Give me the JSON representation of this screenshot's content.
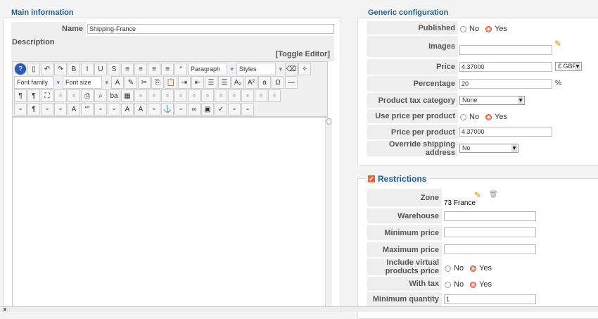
{
  "main": {
    "legend": "Main information",
    "name_label": "Name",
    "name_value": "Shipping-France",
    "description_label": "Description",
    "toggle_editor": "[Toggle Editor]",
    "editor": {
      "format_select": "Paragraph",
      "styles_select": "Styles",
      "font_family": "Font family",
      "font_size": "Font size",
      "row1": [
        "help-icon",
        "new-document-icon",
        "undo-icon",
        "redo-icon",
        "bold-icon",
        "italic-icon",
        "underline-icon",
        "strikethrough-icon",
        "align-justify-icon",
        "align-center-icon",
        "align-left-icon",
        "align-right-icon",
        "blockquote-icon"
      ],
      "row1b": [
        "eraser-icon",
        "cleanup-icon"
      ],
      "row2": [
        "text-color-icon",
        "highlight-icon",
        "cut-icon",
        "copy-icon",
        "paste-icon",
        "indent-icon",
        "outdent-icon",
        "numbered-list-icon",
        "bullet-list-icon",
        "subscript-icon",
        "superscript-icon",
        "style-icon",
        "special-char-icon",
        "horizontal-rule-icon"
      ],
      "row3": [
        "ltr-icon",
        "rtl-icon",
        "fullscreen-icon",
        "paste-word-icon",
        "paste-text-icon",
        "print-icon",
        "find-icon",
        "replace-icon",
        "table-icon",
        "delete-table-icon",
        "row-before-icon",
        "row-after-icon",
        "insert-row-icon",
        "insert-col-icon",
        "delete-row-icon",
        "col-before-icon",
        "col-after-icon",
        "delete-col-icon",
        "merge-cells-icon",
        "split-cells-icon"
      ],
      "row4": [
        "visual-aid-icon",
        "show-blocks-icon",
        "template-icon",
        "page-break-icon",
        "styleprops-icon",
        "cite-icon",
        "abbr-icon",
        "acronym-icon",
        "del-icon",
        "ins-icon",
        "attributes-icon",
        "anchor-icon",
        "unlink-icon",
        "link-icon",
        "image-icon",
        "spellcheck-icon",
        "nonbreaking-icon",
        "layer-icon"
      ]
    }
  },
  "generic": {
    "legend": "Generic configuration",
    "published": {
      "label": "Published",
      "no": "No",
      "yes": "Yes"
    },
    "images": {
      "label": "Images",
      "value": ""
    },
    "price": {
      "label": "Price",
      "value": "4.37000",
      "currency": "£ GBP"
    },
    "percentage": {
      "label": "Percentage",
      "value": "20",
      "unit": "%"
    },
    "tax": {
      "label": "Product tax category",
      "value": "None"
    },
    "use_price": {
      "label": "Use price per product",
      "no": "No",
      "yes": "Yes"
    },
    "price_per": {
      "label": "Price per product",
      "value": "4.37000"
    },
    "override": {
      "label": "Override shipping address",
      "value": "No"
    }
  },
  "restrictions": {
    "legend": "Restrictions",
    "zone": {
      "label": "Zone",
      "value": "73 France"
    },
    "warehouse": {
      "label": "Warehouse",
      "value": ""
    },
    "min_price": {
      "label": "Minimum price",
      "value": ""
    },
    "max_price": {
      "label": "Maximum price",
      "value": ""
    },
    "virtual": {
      "label": "Include virtual products price",
      "no": "No",
      "yes": "Yes"
    },
    "with_tax": {
      "label": "With tax",
      "no": "No",
      "yes": "Yes"
    },
    "min_qty": {
      "label": "Minimum quantity",
      "value": "1"
    }
  }
}
